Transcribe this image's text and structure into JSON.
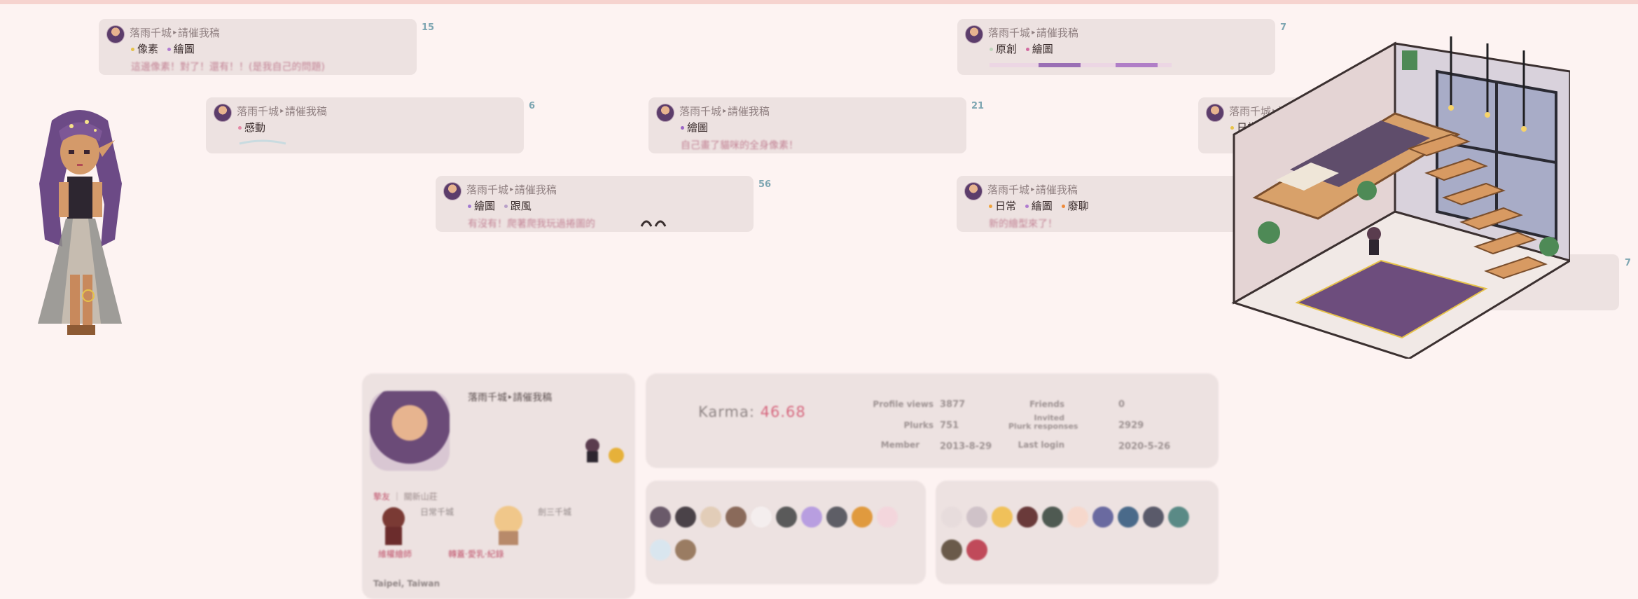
{
  "plurks": [
    {
      "name": "落雨千城‣請催我稿",
      "tags": [
        {
          "label": "像素",
          "color": "#e6c24a"
        },
        {
          "label": "繪圖",
          "color": "#b07bd0"
        }
      ],
      "snippet": "這邊像素！對了！還有！！(是我自己的問題)",
      "count": "15"
    },
    {
      "name": "落雨千城‣請催我稿",
      "tags": [
        {
          "label": "原創",
          "color": "#bfd6bd"
        },
        {
          "label": "繪圖",
          "color": "#d26aa0"
        }
      ],
      "snippet": "",
      "count": "7"
    },
    {
      "name": "落雨千城‣請催我稿",
      "tags": [
        {
          "label": "感動",
          "color": "#e489a6"
        }
      ],
      "snippet": "",
      "count": "6"
    },
    {
      "name": "落雨千城‣請催我稿",
      "tags": [
        {
          "label": "繪圖",
          "color": "#9b67c7"
        }
      ],
      "snippet": "自己畫了貓咪的全身像素！",
      "count": "21"
    },
    {
      "name": "落雨千城‣請催我稿",
      "tags": [
        {
          "label": "日常",
          "color": "#e8c34a"
        }
      ],
      "snippet": "",
      "count": "7"
    },
    {
      "name": "落雨千城‣請催我稿",
      "tags": [
        {
          "label": "繪圖",
          "color": "#a27ad0"
        },
        {
          "label": "跟風",
          "color": "#b8a0c8"
        }
      ],
      "snippet": "有沒有！爬著爬我玩過捲圖的",
      "count": "56"
    },
    {
      "name": "落雨千城‣請催我稿",
      "tags": [
        {
          "label": "日常",
          "color": "#f0a33c"
        },
        {
          "label": "繪圖",
          "color": "#b07bd0"
        },
        {
          "label": "廢聊",
          "color": "#ee8a3a"
        }
      ],
      "snippet": "新的繪型來了！",
      "count": ""
    }
  ],
  "profile": {
    "name": "落雨千城‣請催我稿",
    "relation_label": "摯友",
    "relation_place": "關新山莊",
    "relation_a": "日常千城",
    "relation_b": "劍三千城",
    "relation_c": "維權繪師",
    "relation_d": "轉蓋·愛乳·紀錄",
    "location": "Taipei, Taiwan"
  },
  "karma": {
    "label": "Karma:",
    "value": "46.68"
  },
  "stats": {
    "profile_views_label": "Profile views",
    "profile_views": "3877",
    "plurks_label": "Plurks",
    "plurks": "751",
    "member_label": "Member",
    "member": "2013-8-29",
    "friends_label": "Friends",
    "friends": "0",
    "invited_label": "Invited",
    "invited": "2929",
    "plurk_responses_label": "Plurk responses",
    "last_login_label": "Last login",
    "last_login": "2020-5-26"
  },
  "colors": {
    "background": "#fdf3f2",
    "card": "#ede2e1",
    "count": "#7ea6b2",
    "karma": "#d6677e"
  }
}
